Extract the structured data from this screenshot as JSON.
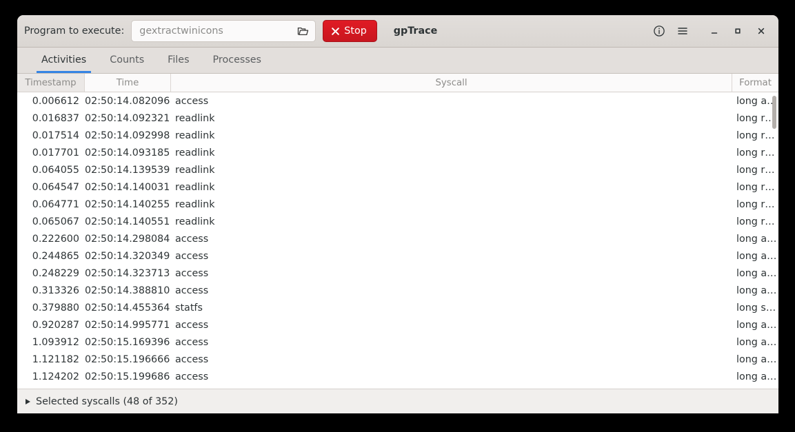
{
  "window": {
    "title": "gpTrace"
  },
  "headerbar": {
    "program_label": "Program to execute:",
    "program_value": "gextractwinicons",
    "program_placeholder": "gextractwinicons",
    "browse_icon": "open-folder-icon",
    "stop_label": "Stop",
    "stop_icon": "close-x-icon",
    "stop_color": "#e01b24",
    "about_icon": "info-circle-icon",
    "menu_icon": "hamburger-menu-icon",
    "minimize_icon": "minimize-icon",
    "maximize_icon": "maximize-icon",
    "close_icon": "window-close-icon"
  },
  "tabs": [
    {
      "label": "Activities",
      "active": true
    },
    {
      "label": "Counts",
      "active": false
    },
    {
      "label": "Files",
      "active": false
    },
    {
      "label": "Processes",
      "active": false
    }
  ],
  "accent_color": "#3584e4",
  "table": {
    "columns": [
      "Timestamp",
      "Time",
      "Syscall",
      "Format"
    ],
    "sorted_column": "Timestamp",
    "rows": [
      {
        "timestamp": "0.006612",
        "time": "02:50:14.082096",
        "syscall": "access",
        "format": "long a…"
      },
      {
        "timestamp": "0.016837",
        "time": "02:50:14.092321",
        "syscall": "readlink",
        "format": "long r…"
      },
      {
        "timestamp": "0.017514",
        "time": "02:50:14.092998",
        "syscall": "readlink",
        "format": "long r…"
      },
      {
        "timestamp": "0.017701",
        "time": "02:50:14.093185",
        "syscall": "readlink",
        "format": "long r…"
      },
      {
        "timestamp": "0.064055",
        "time": "02:50:14.139539",
        "syscall": "readlink",
        "format": "long r…"
      },
      {
        "timestamp": "0.064547",
        "time": "02:50:14.140031",
        "syscall": "readlink",
        "format": "long r…"
      },
      {
        "timestamp": "0.064771",
        "time": "02:50:14.140255",
        "syscall": "readlink",
        "format": "long r…"
      },
      {
        "timestamp": "0.065067",
        "time": "02:50:14.140551",
        "syscall": "readlink",
        "format": "long r…"
      },
      {
        "timestamp": "0.222600",
        "time": "02:50:14.298084",
        "syscall": "access",
        "format": "long a…"
      },
      {
        "timestamp": "0.244865",
        "time": "02:50:14.320349",
        "syscall": "access",
        "format": "long a…"
      },
      {
        "timestamp": "0.248229",
        "time": "02:50:14.323713",
        "syscall": "access",
        "format": "long a…"
      },
      {
        "timestamp": "0.313326",
        "time": "02:50:14.388810",
        "syscall": "access",
        "format": "long a…"
      },
      {
        "timestamp": "0.379880",
        "time": "02:50:14.455364",
        "syscall": "statfs",
        "format": "long s…"
      },
      {
        "timestamp": "0.920287",
        "time": "02:50:14.995771",
        "syscall": "access",
        "format": "long a…"
      },
      {
        "timestamp": "1.093912",
        "time": "02:50:15.169396",
        "syscall": "access",
        "format": "long a…"
      },
      {
        "timestamp": "1.121182",
        "time": "02:50:15.196666",
        "syscall": "access",
        "format": "long a…"
      },
      {
        "timestamp": "1.124202",
        "time": "02:50:15.199686",
        "syscall": "access",
        "format": "long a…"
      }
    ]
  },
  "statusbar": {
    "expander_label": "Selected syscalls (48 of 352)",
    "expander_icon": "triangle-right-icon"
  }
}
